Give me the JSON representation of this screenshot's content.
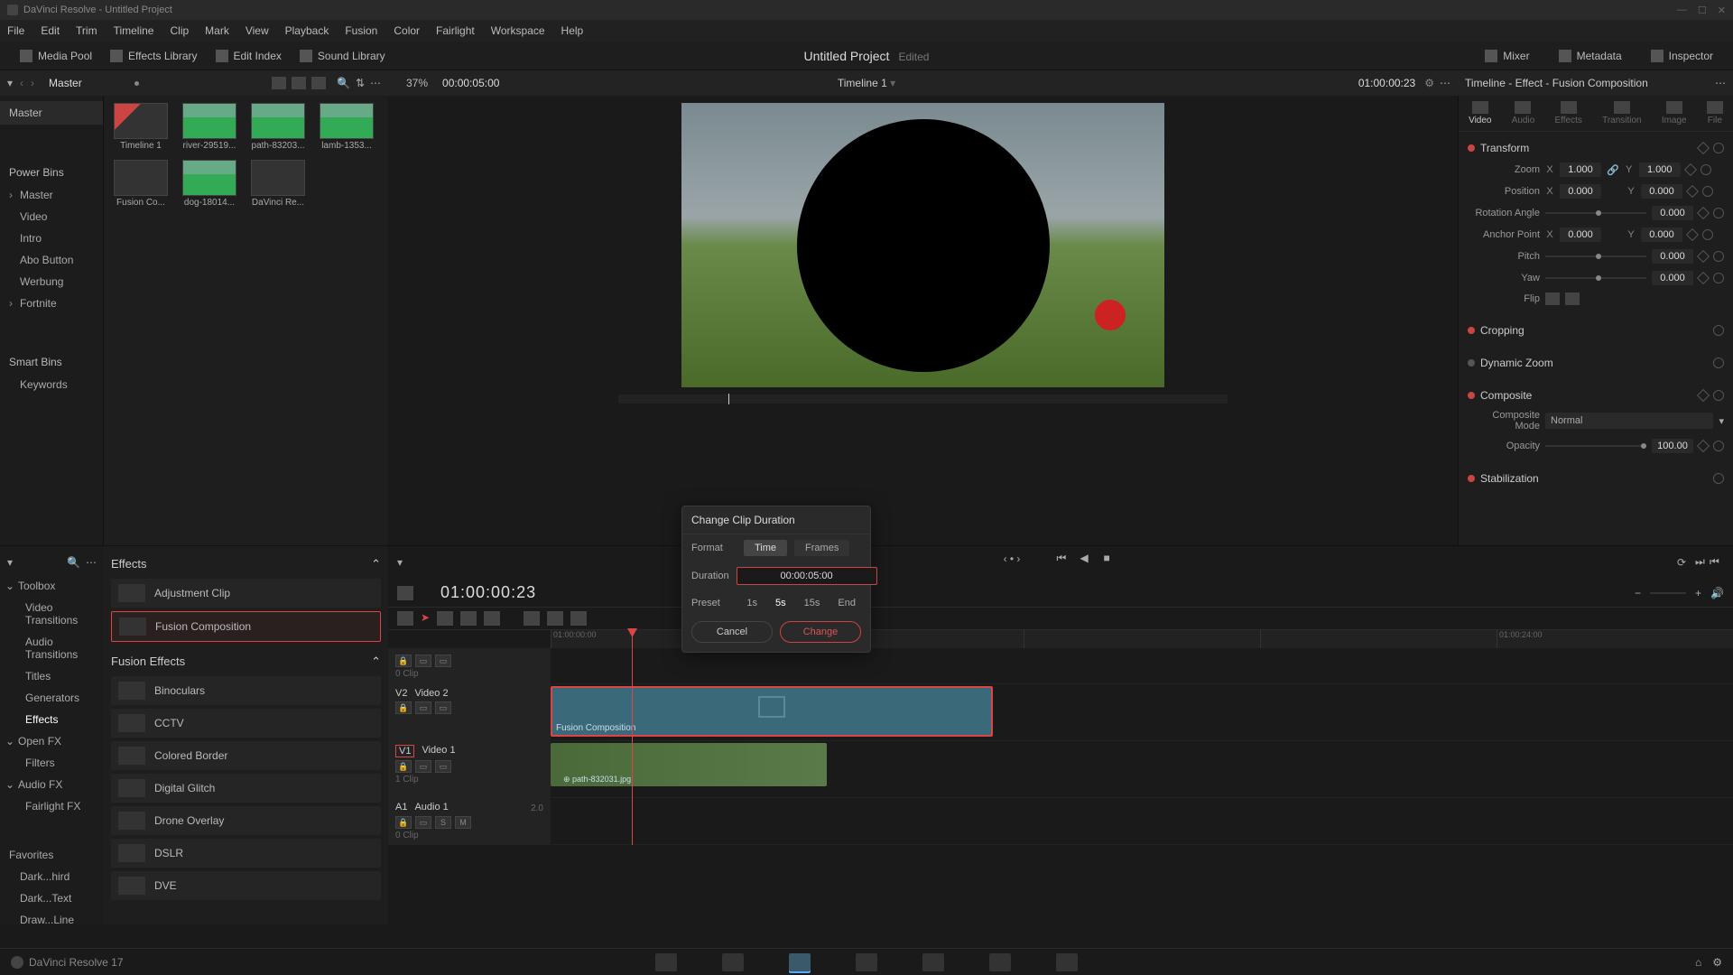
{
  "titlebar": {
    "text": "DaVinci Resolve - Untitled Project"
  },
  "menubar": [
    "File",
    "Edit",
    "Trim",
    "Timeline",
    "Clip",
    "Mark",
    "View",
    "Playback",
    "Fusion",
    "Color",
    "Fairlight",
    "Workspace",
    "Help"
  ],
  "toolbar": {
    "media_pool": "Media Pool",
    "effects_library": "Effects Library",
    "edit_index": "Edit Index",
    "sound_library": "Sound Library",
    "mixer": "Mixer",
    "metadata": "Metadata",
    "inspector": "Inspector",
    "project": "Untitled Project",
    "edited": "Edited"
  },
  "subheader": {
    "master": "Master",
    "zoom": "37%",
    "timecode": "00:00:05:00",
    "timeline_name": "Timeline 1",
    "tc_right": "01:00:00:23",
    "inspector_title": "Timeline - Effect - Fusion Composition"
  },
  "media_tree": {
    "master": "Master",
    "power_bins": "Power Bins",
    "master2": "Master",
    "items": [
      "Video",
      "Intro",
      "Abo Button",
      "Werbung",
      "Fortnite"
    ],
    "smart_bins": "Smart Bins",
    "keywords": "Keywords"
  },
  "media_thumbs": [
    {
      "name": "Timeline 1"
    },
    {
      "name": "river-29519..."
    },
    {
      "name": "path-83203..."
    },
    {
      "name": "lamb-1353..."
    },
    {
      "name": "Fusion Co..."
    },
    {
      "name": "dog-18014..."
    },
    {
      "name": "DaVinci Re..."
    }
  ],
  "inspector_tabs": [
    "Video",
    "Audio",
    "Effects",
    "Transition",
    "Image",
    "File"
  ],
  "transform": {
    "title": "Transform",
    "zoom_label": "Zoom",
    "zoom_x": "1.000",
    "zoom_y": "1.000",
    "position_label": "Position",
    "pos_x": "0.000",
    "pos_y": "0.000",
    "rotation_label": "Rotation Angle",
    "rotation": "0.000",
    "anchor_label": "Anchor Point",
    "anchor_x": "0.000",
    "anchor_y": "0.000",
    "pitch_label": "Pitch",
    "pitch": "0.000",
    "yaw_label": "Yaw",
    "yaw": "0.000",
    "flip_label": "Flip"
  },
  "insp_sections": {
    "cropping": "Cropping",
    "dynamic_zoom": "Dynamic Zoom",
    "composite": "Composite",
    "composite_mode_label": "Composite Mode",
    "composite_mode": "Normal",
    "opacity_label": "Opacity",
    "opacity": "100.00",
    "stabilization": "Stabilization"
  },
  "effects_tree": {
    "toolbox": "Toolbox",
    "items": [
      "Video Transitions",
      "Audio Transitions",
      "Titles",
      "Generators",
      "Effects"
    ],
    "open_fx": "Open FX",
    "filters": "Filters",
    "audio_fx": "Audio FX",
    "fairlight_fx": "Fairlight FX",
    "favorites": "Favorites",
    "fav_items": [
      "Dark...hird",
      "Dark...Text",
      "Draw...Line"
    ]
  },
  "effects_list": {
    "header1": "Effects",
    "items1": [
      "Adjustment Clip",
      "Fusion Composition"
    ],
    "header2": "Fusion Effects",
    "items2": [
      "Binoculars",
      "CCTV",
      "Colored Border",
      "Digital Glitch",
      "Drone Overlay",
      "DSLR",
      "DVE"
    ]
  },
  "timeline": {
    "tc_big": "01:00:00:23",
    "ruler": [
      "01:00:00:00",
      "",
      "",
      "",
      "01:00:24:00"
    ],
    "tracks": {
      "v2": {
        "id": "V2",
        "name": "Video 2",
        "clip": "Fusion Composition"
      },
      "v1": {
        "id": "V1",
        "name": "Video 1",
        "sub": "1 Clip",
        "clip": "path-832031.jpg"
      },
      "a1": {
        "id": "A1",
        "name": "Audio 1",
        "ch": "2.0",
        "sub": "0 Clip"
      },
      "v3sub": "0 Clip"
    }
  },
  "dialog": {
    "title": "Change Clip Duration",
    "format": "Format",
    "time": "Time",
    "frames": "Frames",
    "duration_label": "Duration",
    "duration_value": "00:00:05:00",
    "preset_label": "Preset",
    "presets": [
      "1s",
      "5s",
      "15s",
      "End"
    ],
    "cancel": "Cancel",
    "change": "Change"
  },
  "bottom": {
    "version": "DaVinci Resolve 17"
  }
}
